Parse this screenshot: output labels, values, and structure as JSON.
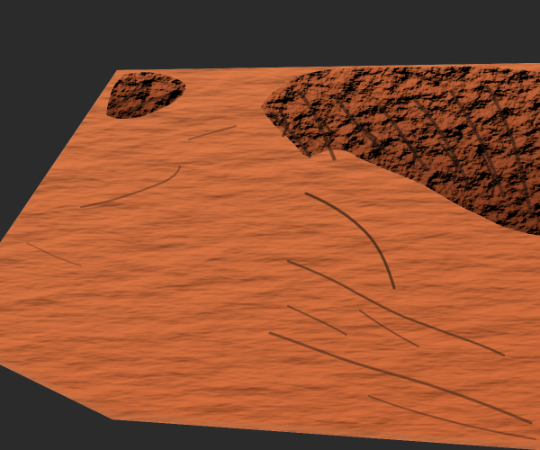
{
  "scene": {
    "background_color": "#2b2b2b",
    "sand_color": "#e9a77d",
    "sand_shadow_color": "#b8724e",
    "sand_highlight_color": "#f6c6a4",
    "rock_dark_color": "#2a1a14",
    "rock_mid_color": "#6b4331"
  }
}
